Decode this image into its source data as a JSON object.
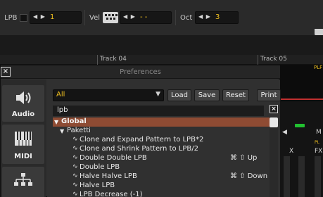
{
  "toolbar": {
    "lpb_label": "LPB",
    "lpb_value": "1",
    "vel_label": "Vel",
    "vel_value": "- -",
    "oct_label": "Oct",
    "oct_value": "3",
    "stepper_arrows": "◀ ▶"
  },
  "tracks": [
    "Track 04",
    "Track 05"
  ],
  "pattern_editor": {
    "plf_text": "PLF",
    "fx_left": "X",
    "fx_right": "FX",
    "knob_label": "M",
    "yel_label": "PL"
  },
  "dialog": {
    "title": "Preferences",
    "close_glyph": "×",
    "nav": [
      {
        "label": "Audio",
        "icon": "speaker-icon"
      },
      {
        "label": "MIDI",
        "icon": "piano-keys-icon"
      },
      {
        "label": "",
        "icon": "network-tree-icon"
      }
    ],
    "filter_value": "All",
    "filter_arrow": "▼",
    "buttons": {
      "load": "Load",
      "save": "Save",
      "reset": "Reset",
      "print": "Print"
    },
    "search_value": "lpb",
    "search_clear": "×",
    "tree": [
      {
        "kind": "group",
        "toggle": "▼",
        "label": "Global"
      },
      {
        "kind": "subgroup",
        "toggle": "▼",
        "label": "Paketti"
      },
      {
        "kind": "item",
        "label": "Clone and Expand Pattern to LPB*2",
        "shortcut": ""
      },
      {
        "kind": "item",
        "label": "Clone and Shrink Pattern to LPB/2",
        "shortcut": ""
      },
      {
        "kind": "item",
        "label": "Double Double LPB",
        "shortcut": "⌘ ⇧ Up"
      },
      {
        "kind": "item",
        "label": "Double LPB",
        "shortcut": ""
      },
      {
        "kind": "item",
        "label": "Halve Halve LPB",
        "shortcut": "⌘ ⇧ Down"
      },
      {
        "kind": "item",
        "label": "Halve LPB",
        "shortcut": ""
      },
      {
        "kind": "item",
        "label": "LPB Decrease (-1)",
        "shortcut": ""
      }
    ],
    "item_glyph": "∿"
  }
}
